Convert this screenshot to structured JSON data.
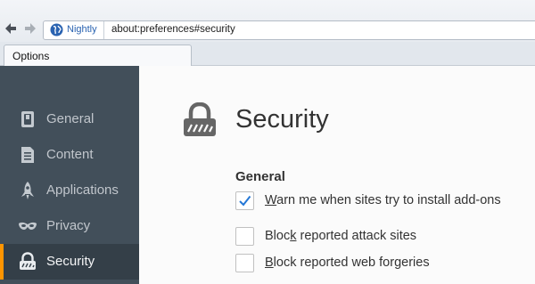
{
  "browser": {
    "identity_label": "Nightly",
    "url": "about:preferences#security",
    "tab_title": "Options"
  },
  "sidebar": {
    "items": [
      {
        "label": "General",
        "icon": "switch-icon"
      },
      {
        "label": "Content",
        "icon": "document-icon"
      },
      {
        "label": "Applications",
        "icon": "rocket-icon"
      },
      {
        "label": "Privacy",
        "icon": "mask-icon"
      },
      {
        "label": "Security",
        "icon": "lock-icon",
        "selected": true
      }
    ]
  },
  "main": {
    "heading": "Security",
    "group_title": "General",
    "prefs": {
      "warn_addons": {
        "before": "",
        "accesskey": "W",
        "after": "arn me when sites try to install add-ons",
        "checked": true
      },
      "block_attack": {
        "before": "Bloc",
        "accesskey": "k",
        "after": " reported attack sites",
        "checked": false
      },
      "block_forgeries": {
        "before": "",
        "accesskey": "B",
        "after": "lock reported web forgeries",
        "checked": false
      }
    }
  },
  "colors": {
    "sidebar_bg": "#424f5a",
    "sidebar_selected_bg": "#343f48",
    "selected_accent": "#ff9500",
    "link_blue": "#2a63b1",
    "checkmark": "#2477d6"
  }
}
